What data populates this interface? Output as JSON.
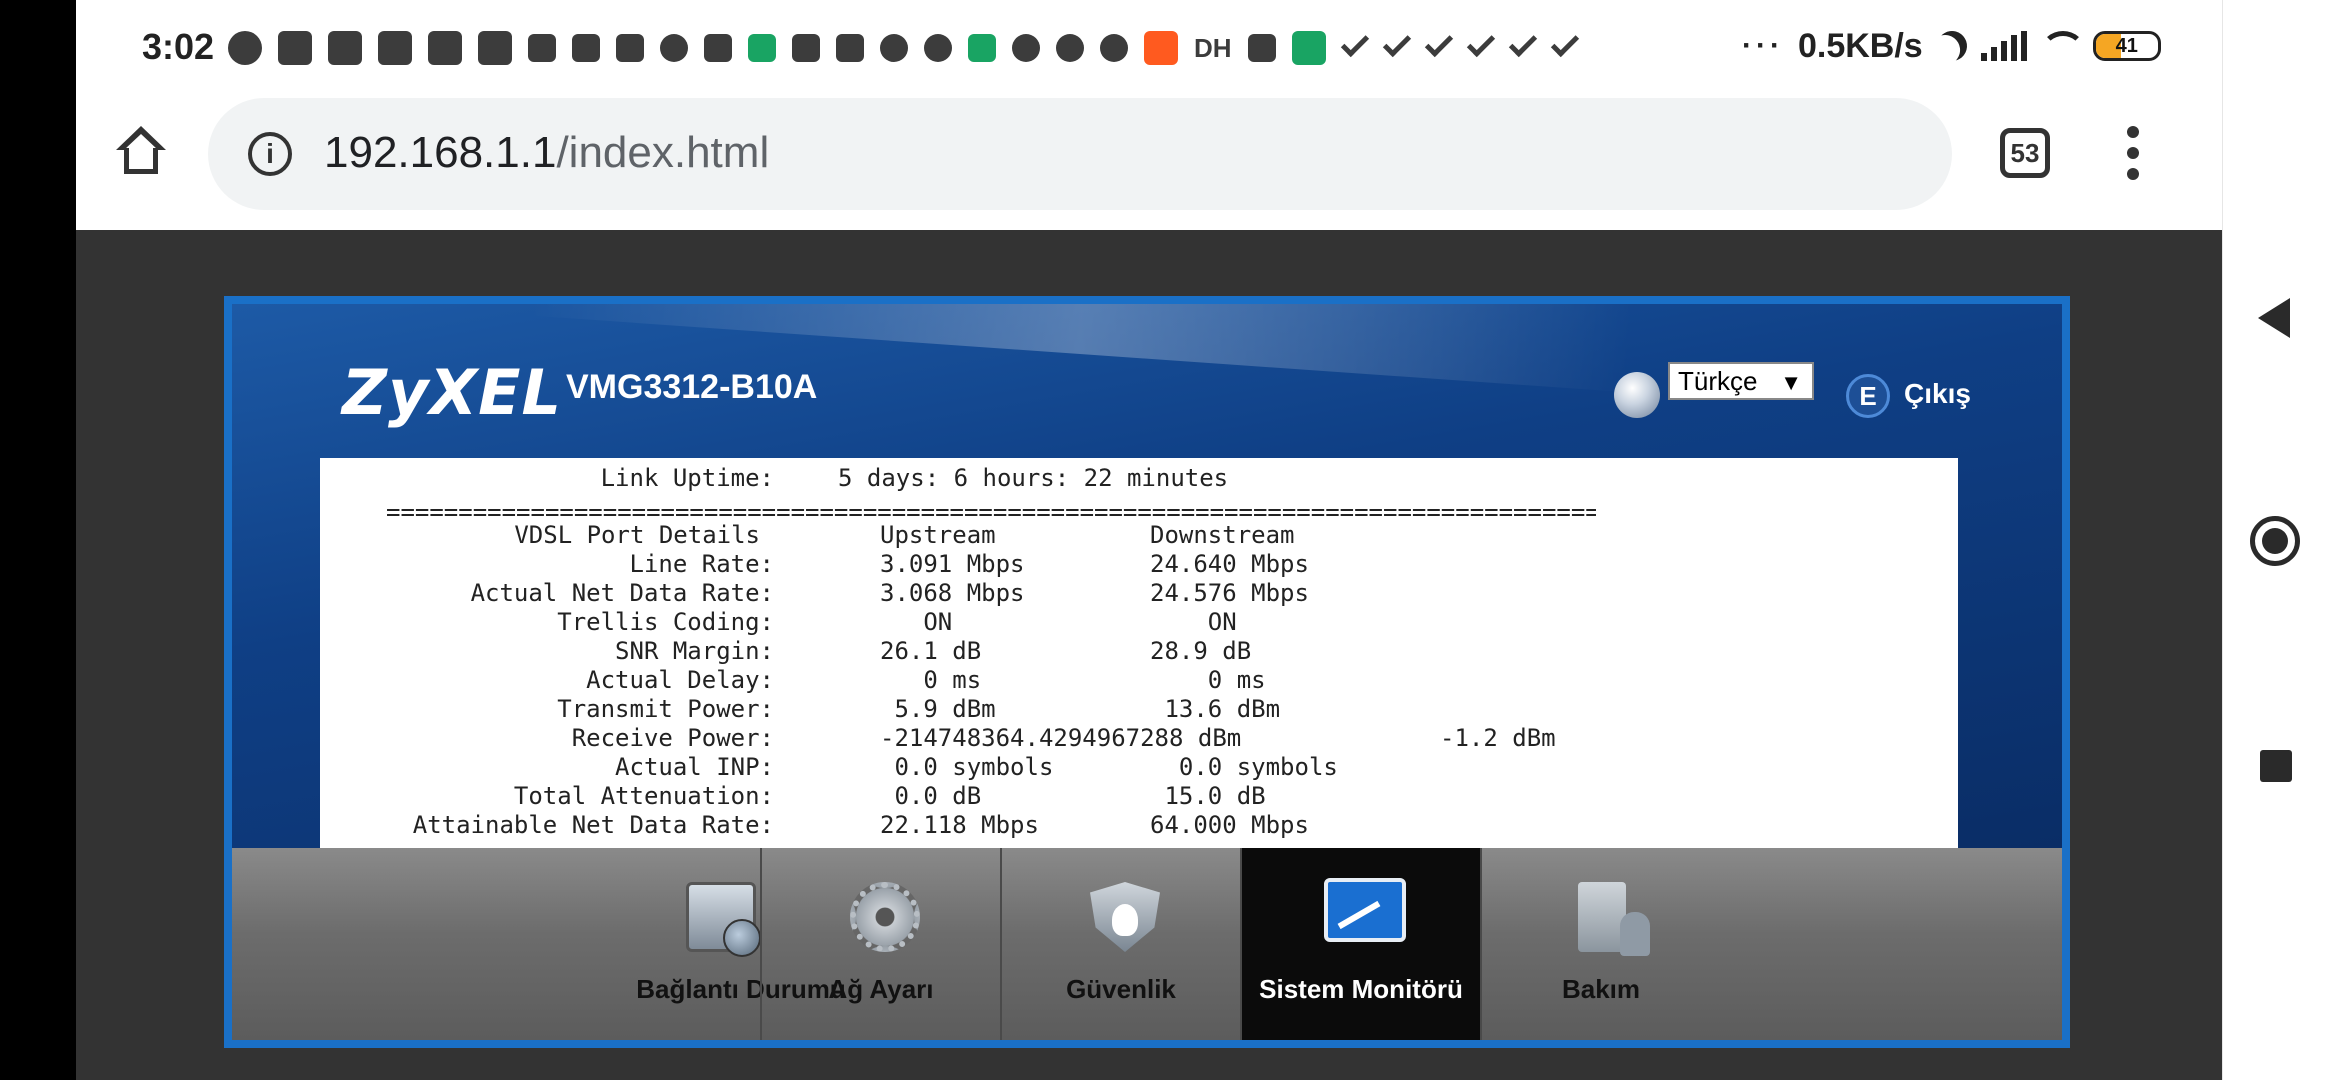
{
  "status_bar": {
    "time": "3:02",
    "notification_icons": [
      "bug-icon",
      "cube-icon",
      "cube-icon",
      "shape-icon",
      "shape-icon",
      "shape-icon",
      "download-icon",
      "mail-icon",
      "mail-icon",
      "paperclip-icon",
      "wattpad-icon",
      "download-green-icon",
      "grid-icon",
      "map-icon",
      "cloud-icon",
      "bell-icon",
      "download-green-icon",
      "bell-icon",
      "keyhole-icon",
      "twitter-icon",
      "orange-app-icon",
      "dh-text",
      "trash-icon",
      "green-c-icon",
      "check-icon",
      "check-icon",
      "check-icon",
      "check-icon",
      "check-icon",
      "check-icon"
    ],
    "dh_label": "DH",
    "more": "···",
    "net_speed": "0.5KB/s",
    "battery_level": "41"
  },
  "browser": {
    "url_host": "192.168.1.1",
    "url_path": "/index.html",
    "tab_count": "53"
  },
  "router": {
    "brand": "ZyXEL",
    "model": "VMG3312-B10A",
    "language": "Türkçe",
    "logout_label": "Çıkış"
  },
  "dsl_info": {
    "link_uptime_label": "Link Uptime:",
    "link_uptime_value": "5 days: 6 hours: 22 minutes",
    "separator": "====================================================================================================",
    "header": {
      "label": "VDSL Port Details",
      "up": "Upstream",
      "down": "Downstream"
    },
    "rows": [
      {
        "label": "Line Rate:",
        "up": "3.091 Mbps",
        "down": "24.640 Mbps",
        "extra": ""
      },
      {
        "label": "Actual Net Data Rate:",
        "up": "3.068 Mbps",
        "down": "24.576 Mbps",
        "extra": ""
      },
      {
        "label": "Trellis Coding:",
        "up": "   ON",
        "down": "    ON",
        "extra": ""
      },
      {
        "label": "SNR Margin:",
        "up": "26.1 dB",
        "down": "28.9 dB",
        "extra": ""
      },
      {
        "label": "Actual Delay:",
        "up": "   0 ms",
        "down": "    0 ms",
        "extra": ""
      },
      {
        "label": "Transmit Power:",
        "up": " 5.9 dBm",
        "down": " 13.6 dBm",
        "extra": ""
      },
      {
        "label": "Receive Power:",
        "up": "-214748364.4294967288 dBm",
        "down": "",
        "extra": "-1.2 dBm"
      },
      {
        "label": "Actual INP:",
        "up": " 0.0 symbols",
        "down": "  0.0 symbols",
        "extra": ""
      },
      {
        "label": "Total Attenuation:",
        "up": " 0.0 dB",
        "down": " 15.0 dB",
        "extra": ""
      },
      {
        "label": "Attainable Net Data Rate:",
        "up": "22.118 Mbps",
        "down": "64.000 Mbps",
        "extra": ""
      }
    ]
  },
  "menu": {
    "items": [
      {
        "label": "Bağlantı Durumu",
        "icon": "connection-status-icon"
      },
      {
        "label": "Ağ Ayarı",
        "icon": "gear-icon"
      },
      {
        "label": "Güvenlik",
        "icon": "shield-icon"
      },
      {
        "label": "Sistem Monitörü",
        "icon": "monitor-chart-icon",
        "active": true
      },
      {
        "label": "Bakım",
        "icon": "maintenance-icon"
      }
    ]
  }
}
